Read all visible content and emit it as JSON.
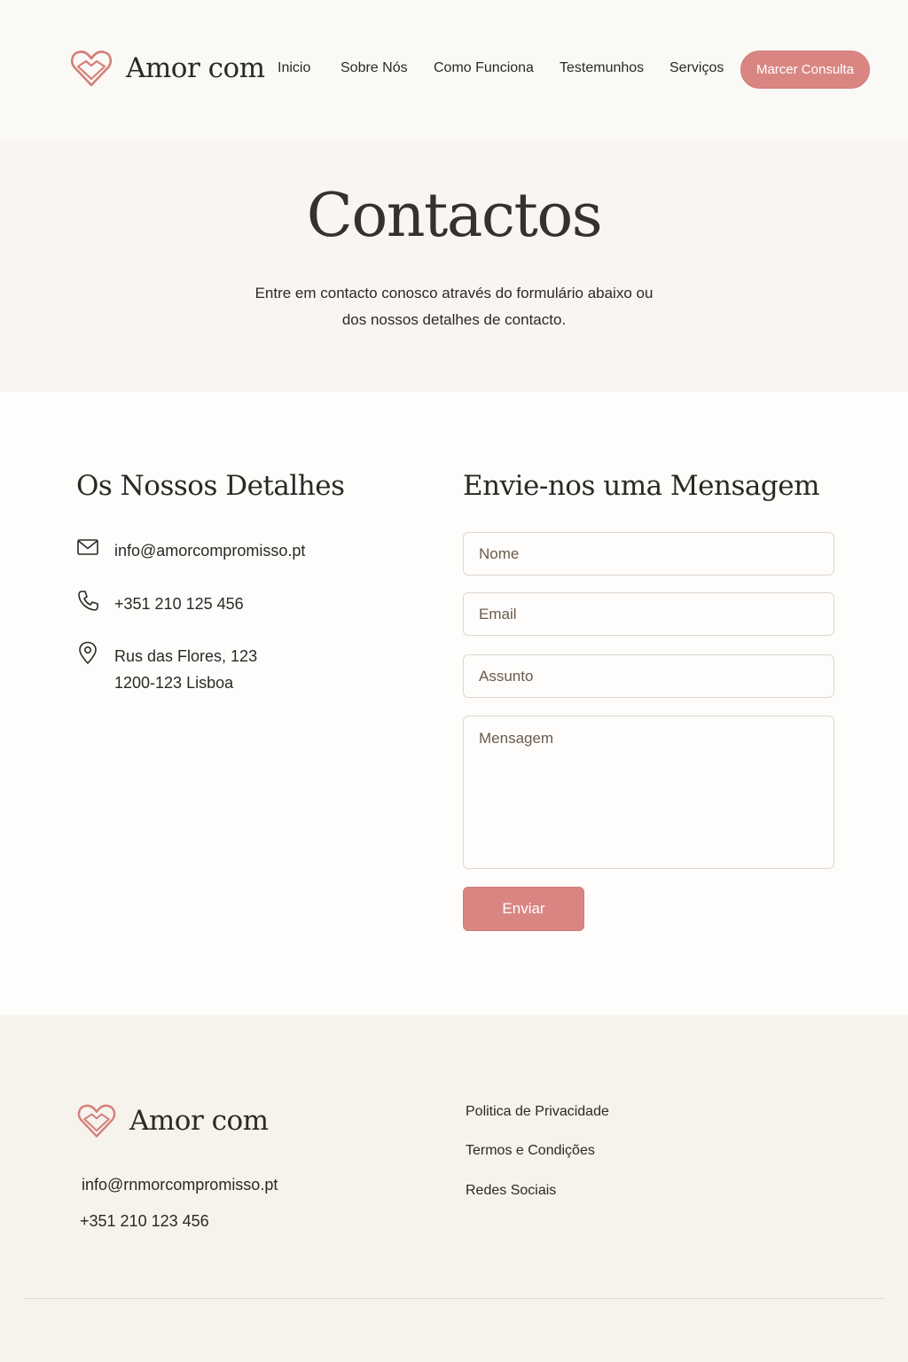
{
  "brand": {
    "name": "Amor com",
    "accent": "#d98682"
  },
  "nav": {
    "items": [
      "Inicio",
      "Sobre Nós",
      "Como Funciona",
      "Testemunhos",
      "Serviços"
    ],
    "cta": "Marcer Consulta"
  },
  "hero": {
    "title": "Contactos",
    "subtitle_line1": "Entre em contacto conosco através do formulário abaixo ou",
    "subtitle_line2": "dos nossos detalhes de contacto."
  },
  "details": {
    "heading": "Os Nossos Detalhes",
    "email": "info@amorcompromisso.pt",
    "phone": "+351 210 125 456",
    "address_line1": "Rus das Flores, 123",
    "address_line2": "1200-123 Lisboa",
    "icons": [
      "mail-icon",
      "phone-icon",
      "location-pin-icon"
    ]
  },
  "form": {
    "heading": "Envie-nos uma Mensagem",
    "name_placeholder": "Nome",
    "email_placeholder": "Email",
    "subject_placeholder": "Assunto",
    "message_placeholder": "Mensagem",
    "submit": "Enviar"
  },
  "footer": {
    "brand": "Amor com",
    "email": "info@rnmorcompromisso.pt",
    "phone": "+351 210 123 456",
    "links": [
      "Politica de Privacidade",
      "Termos e Condições",
      "Redes Sociais"
    ]
  }
}
